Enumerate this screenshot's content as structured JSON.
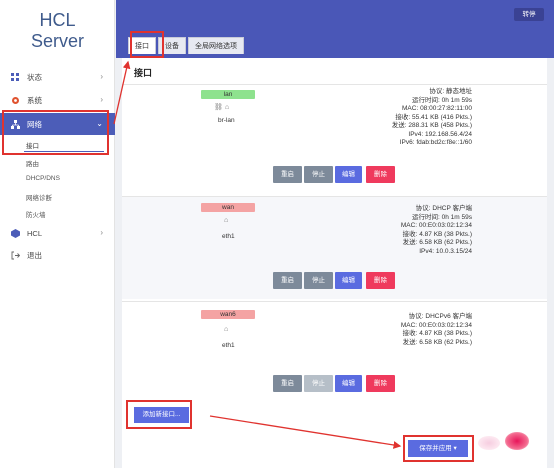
{
  "app": {
    "title_line1": "HCL",
    "title_line2": "Server",
    "logout": "转停"
  },
  "sidebar": {
    "items": [
      {
        "label": "状态"
      },
      {
        "label": "系统"
      },
      {
        "label": "网络"
      },
      {
        "label": "HCL"
      },
      {
        "label": "退出"
      }
    ],
    "network_sub": [
      {
        "label": "接口"
      },
      {
        "label": "路由"
      },
      {
        "label": "DHCP/DNS"
      },
      {
        "label": "网络诊断"
      },
      {
        "label": "防火墙"
      }
    ]
  },
  "tabs": [
    {
      "label": "接口"
    },
    {
      "label": "设备"
    },
    {
      "label": "全局网络选项"
    }
  ],
  "panel": {
    "title": "接口"
  },
  "interfaces": [
    {
      "name": "lan",
      "device": "br-lan",
      "protocol": "协议: 静态地址",
      "uptime": "运行时间: 0h 1m 59s",
      "mac": "MAC: 08:00:27:82:11:00",
      "rx": "接收: 55.41 KB (416 Pkts.)",
      "tx": "发送: 288.31 KB (458 Pkts.)",
      "ip4": "IPv4: 192.168.56.4/24",
      "ip6": "IPv6: fdab:bd2c:f8e::1/60"
    },
    {
      "name": "wan",
      "device": "eth1",
      "protocol": "协议: DHCP 客户端",
      "uptime": "运行时间: 0h 1m 59s",
      "mac": "MAC: 00:E0:03:02:12:34",
      "rx": "接收: 4.87 KB (38 Pkts.)",
      "tx": "发送: 6.58 KB (62 Pkts.)",
      "ip4": "IPv4: 10.0.3.15/24"
    },
    {
      "name": "wan6",
      "device": "eth1",
      "protocol": "协议: DHCPv6 客户端",
      "mac": "MAC: 00:E0:03:02:12:34",
      "rx": "接收: 4.87 KB (38 Pkts.)",
      "tx": "发送: 6.58 KB (62 Pkts.)"
    }
  ],
  "actions": {
    "restart": "重启",
    "stop": "停止",
    "edit": "编辑",
    "delete": "删除"
  },
  "add_button": "添加新接口...",
  "save_button": "保存并应用",
  "save_caret": "▾",
  "colors": {
    "accent": "#4a57b7",
    "danger": "#ef3a5d",
    "highlight": "#e0332f"
  }
}
